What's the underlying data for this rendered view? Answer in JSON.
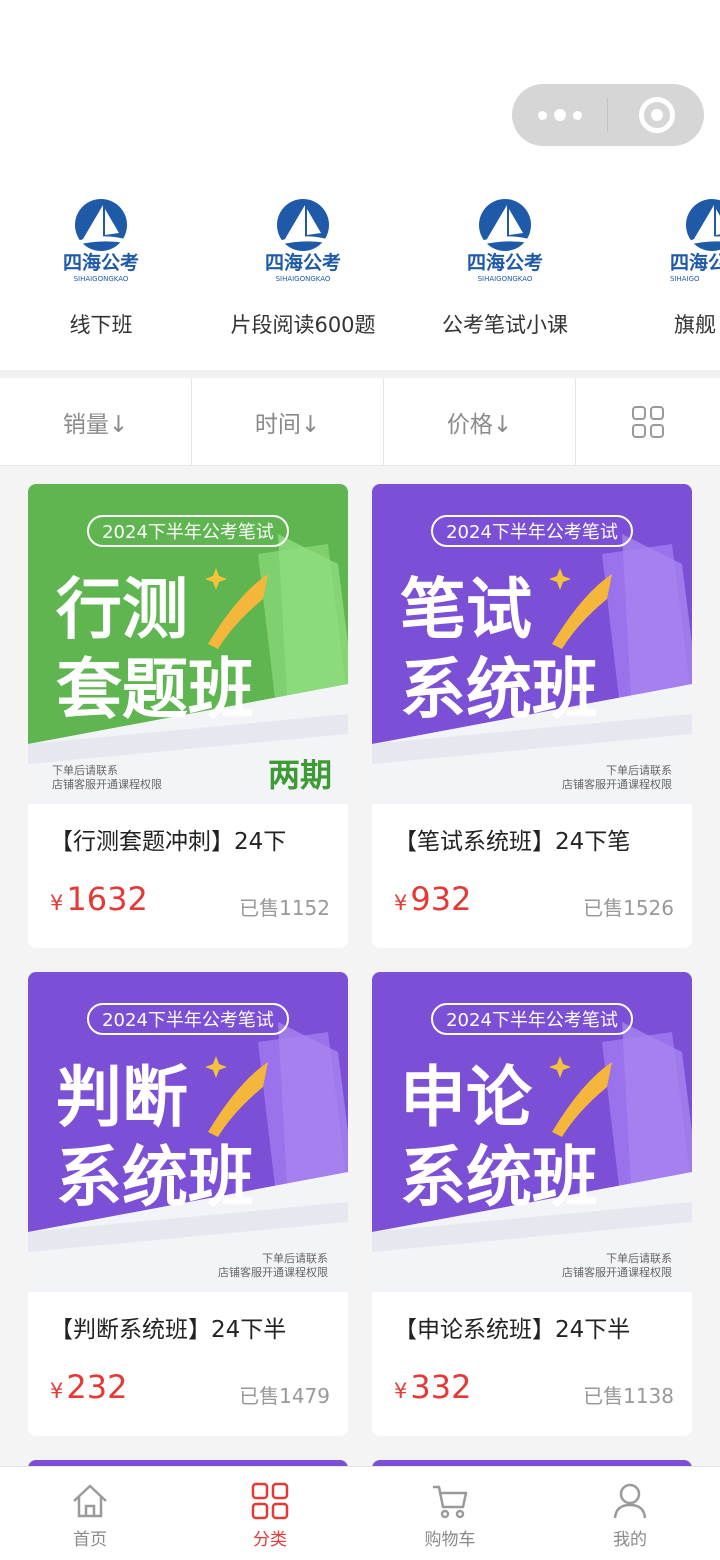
{
  "categories": [
    {
      "label": "线下班",
      "logo_text": "四海公考",
      "logo_sub": "SIHAIGONGKAO"
    },
    {
      "label": "片段阅读600题",
      "logo_text": "四海公考",
      "logo_sub": "SIHAIGONGKAO"
    },
    {
      "label": "公考笔试小课",
      "logo_text": "四海公考",
      "logo_sub": "SIHAIGONGKAO"
    },
    {
      "label": "旗舰",
      "logo_text": "四海公",
      "logo_sub": "SIHAIGO"
    }
  ],
  "sort": {
    "sales": "销量↓",
    "time": "时间↓",
    "price": "价格↓"
  },
  "products": [
    {
      "badge": "2024下半年公考笔试",
      "cover_line1": "行测",
      "cover_line2": "套题班",
      "corner": "两期",
      "note1": "下单后请联系",
      "note2": "店铺客服开通课程权限",
      "title": "【行测套题冲刺】24下",
      "currency": "¥",
      "price": "1632",
      "sold": "已售1152",
      "theme": "#5fb650"
    },
    {
      "badge": "2024下半年公考笔试",
      "cover_line1": "笔试",
      "cover_line2": "系统班",
      "corner": "",
      "note1": "下单后请联系",
      "note2": "店铺客服开通课程权限",
      "title": "【笔试系统班】24下笔",
      "currency": "¥",
      "price": "932",
      "sold": "已售1526",
      "theme": "#7b4fd6"
    },
    {
      "badge": "2024下半年公考笔试",
      "cover_line1": "判断",
      "cover_line2": "系统班",
      "corner": "",
      "note1": "下单后请联系",
      "note2": "店铺客服开通课程权限",
      "title": "【判断系统班】24下半",
      "currency": "¥",
      "price": "232",
      "sold": "已售1479",
      "theme": "#7b4fd6"
    },
    {
      "badge": "2024下半年公考笔试",
      "cover_line1": "申论",
      "cover_line2": "系统班",
      "corner": "",
      "note1": "下单后请联系",
      "note2": "店铺客服开通课程权限",
      "title": "【申论系统班】24下半",
      "currency": "¥",
      "price": "332",
      "sold": "已售1138",
      "theme": "#7b4fd6"
    }
  ],
  "tabs": [
    {
      "label": "首页",
      "icon": "home-icon"
    },
    {
      "label": "分类",
      "icon": "category-grid-icon",
      "active": true
    },
    {
      "label": "购物车",
      "icon": "cart-icon"
    },
    {
      "label": "我的",
      "icon": "user-icon"
    }
  ],
  "colors": {
    "accent": "#e53935",
    "brand_blue": "#1e5aa8"
  }
}
